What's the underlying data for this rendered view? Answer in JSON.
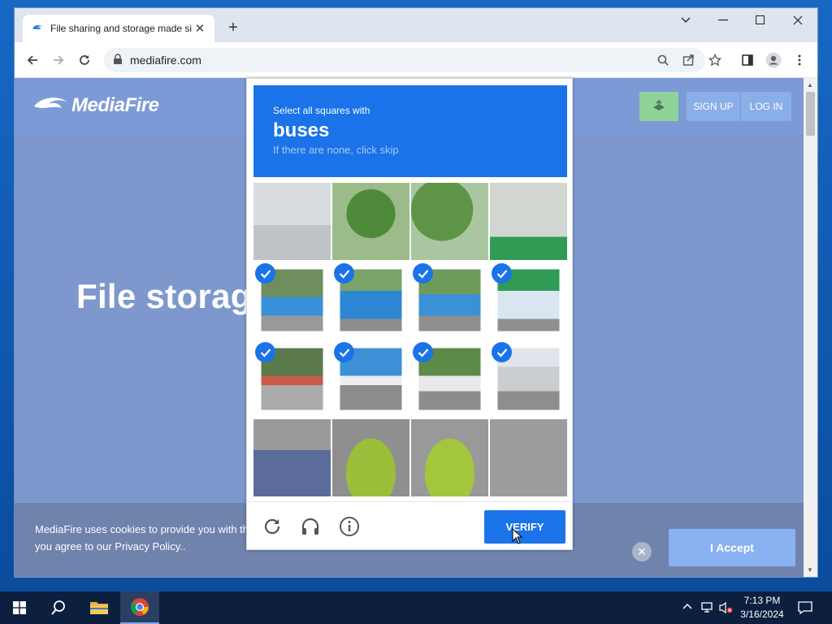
{
  "browser": {
    "tab_title": "File sharing and storage made si",
    "url": "mediafire.com"
  },
  "site": {
    "brand": "MediaFire",
    "signup": "SIGN UP",
    "login": "LOG IN",
    "headline": "File storage made simple",
    "cookie_line1": "MediaFire uses cookies to provide you with the best experience. By using our website,",
    "cookie_line2": "you agree to our Privacy Policy..",
    "accept": "I Accept"
  },
  "captcha": {
    "instruction": "Select all squares with",
    "target": "buses",
    "hint": "If there are none, click skip",
    "verify": "VERIFY",
    "selected_cells": [
      4,
      5,
      6,
      7,
      8,
      9,
      10,
      11
    ]
  },
  "taskbar": {
    "time": "7:13 PM",
    "date": "3/16/2024"
  }
}
